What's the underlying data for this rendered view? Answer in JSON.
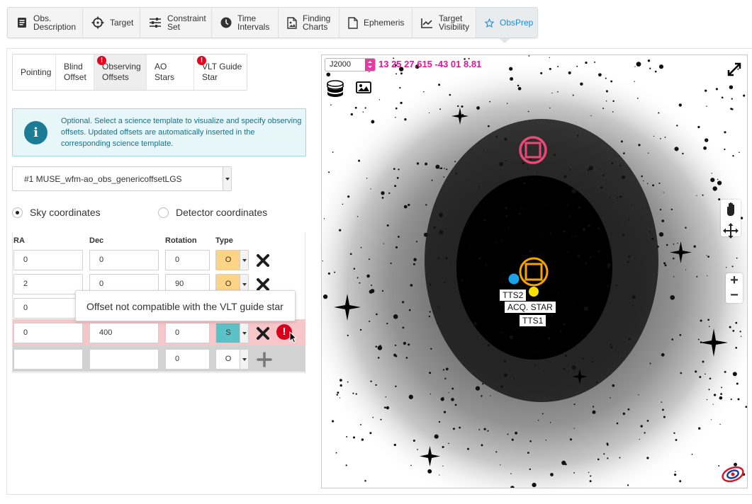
{
  "topnav": [
    {
      "label": "Obs.\nDescription",
      "icon": "document-list-icon"
    },
    {
      "label": "Target",
      "icon": "crosshair-icon"
    },
    {
      "label": "Constraint\nSet",
      "icon": "sliders-icon"
    },
    {
      "label": "Time\nIntervals",
      "icon": "clock-icon"
    },
    {
      "label": "Finding\nCharts",
      "icon": "image-file-icon"
    },
    {
      "label": "Ephemeris",
      "icon": "file-icon"
    },
    {
      "label": "Target\nVisibility",
      "icon": "line-chart-icon"
    },
    {
      "label": "ObsPrep",
      "icon": "star-icon",
      "active": true
    }
  ],
  "subtabs": [
    {
      "label": "Pointing"
    },
    {
      "label": "Blind\nOffset"
    },
    {
      "label": "Observing\nOffsets",
      "warning": true,
      "active": true
    },
    {
      "label": "AO Stars"
    },
    {
      "label": "VLT Guide\nStar",
      "warning": true
    }
  ],
  "warning_glyph": "!",
  "info": {
    "glyph": "i",
    "text": "Optional. Select a science template to visualize and specify observing offsets. Updated offsets are automatically inserted in the corresponding science template."
  },
  "template": {
    "selected": "#1 MUSE_wfm-ao_obs_genericoffsetLGS"
  },
  "coord_mode": {
    "sky_label": "Sky coordinates",
    "detector_label": "Detector coordinates",
    "selected": "sky"
  },
  "table": {
    "headers": [
      "RA",
      "Dec",
      "Rotation",
      "Type"
    ],
    "rows": [
      {
        "ra": "0",
        "dec": "0",
        "rot": "0",
        "type": "O"
      },
      {
        "ra": "2",
        "dec": "0",
        "rot": "90",
        "type": "O"
      },
      {
        "ra": "0",
        "dec": "",
        "rot": "",
        "type": ""
      },
      {
        "ra": "0",
        "dec": "400",
        "rot": "0",
        "type": "S",
        "error": true
      },
      {
        "ra": "",
        "dec": "",
        "rot": "0",
        "type": "O"
      }
    ],
    "error_glyph": "!"
  },
  "tooltip": "Offset not compatible with the VLT guide star",
  "skyview": {
    "frame": "J2000",
    "coords": "13 25 27.615 -43 01 8.81",
    "labels": {
      "tts2": "TTS2",
      "acq": "ACQ. STAR",
      "tts1": "TTS1"
    },
    "zoom_in": "+",
    "zoom_out": "−",
    "colors": {
      "pink": "#e8497a",
      "orange": "#f5a300",
      "blue": "#1ba3e8",
      "yellow": "#f7e000",
      "coords": "#e0169b"
    }
  }
}
